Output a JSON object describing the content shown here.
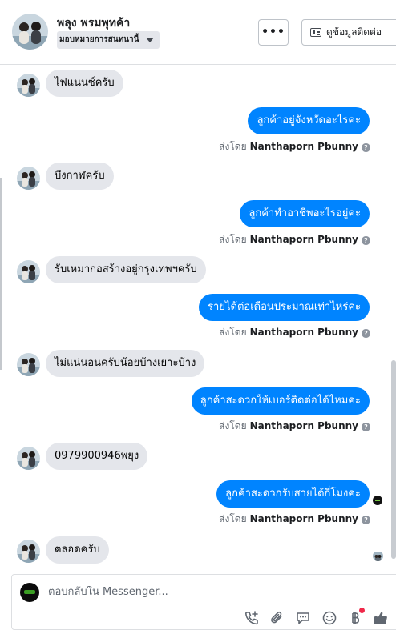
{
  "header": {
    "contact_name": "พลุง พรมพุทค้า",
    "assign_label": "มอบหมายการสนทนานี้",
    "more_label": "•••",
    "contact_info_label": "ดูข้อมูลติดต่อ"
  },
  "messages": [
    {
      "direction": "in",
      "text": "ไฟแนนซ์ครับ"
    },
    {
      "direction": "out",
      "text": "ลูกค้าอยู่จังหวัดอะไรคะ",
      "sent_by_prefix": "ส่งโดย",
      "sender": "Nanthaporn Pbunny"
    },
    {
      "direction": "in",
      "text": "บึงกาฬครับ"
    },
    {
      "direction": "out",
      "text": "ลูกค้าทำอาชีพอะไรอยู่คะ",
      "sent_by_prefix": "ส่งโดย",
      "sender": "Nanthaporn Pbunny"
    },
    {
      "direction": "in",
      "text": "รับเหมาก่อสร้างอยู่กรุงเทพฯครับ"
    },
    {
      "direction": "out",
      "text": "รายได้ต่อเดือนประมาณเท่าไหร่คะ",
      "sent_by_prefix": "ส่งโดย",
      "sender": "Nanthaporn Pbunny"
    },
    {
      "direction": "in",
      "text": "ไม่แน่นอนครับน้อยบ้างเยาะบ้าง"
    },
    {
      "direction": "out",
      "text": "ลูกค้าสะดวกให้เบอร์ติดต่อได้ไหมคะ",
      "sent_by_prefix": "ส่งโดย",
      "sender": "Nanthaporn Pbunny"
    },
    {
      "direction": "in",
      "text": "0979900946พยุง"
    },
    {
      "direction": "out",
      "text": "ลูกค้าสะดวกรับสายได้กี่โมงคะ",
      "sent_by_prefix": "ส่งโดย",
      "sender": "Nanthaporn Pbunny"
    },
    {
      "direction": "in",
      "text": "ตลอดครับ"
    }
  ],
  "composer": {
    "placeholder": "ตอบกลับใน Messenger...",
    "tools": [
      "phone-add-icon",
      "paperclip-icon",
      "saved-reply-icon",
      "emoji-icon",
      "baht-icon",
      "thumbs-up-icon"
    ]
  },
  "colors": {
    "outgoing_bubble": "#0084ff",
    "incoming_bubble": "#e4e6eb",
    "notification_dot": "#f02849"
  }
}
